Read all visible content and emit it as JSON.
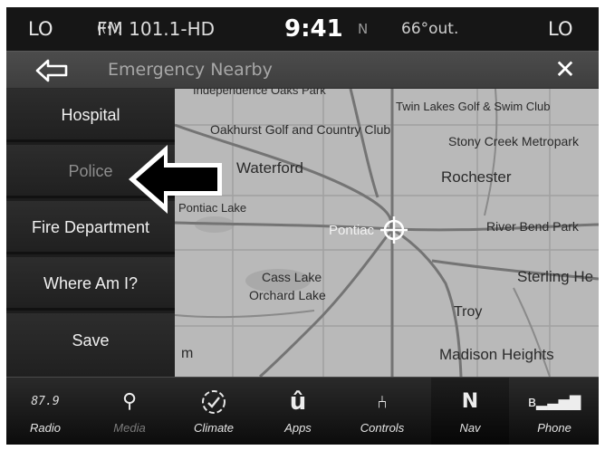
{
  "status": {
    "left_temp": "LO",
    "radio_icon": "radio-signal-icon",
    "station": "FM 101.1-HD",
    "time": "9:41",
    "heading": "N",
    "outside_temp": "66°out.",
    "right_temp": "LO"
  },
  "titlebar": {
    "back_icon": "back-arrow-icon",
    "title": "Emergency Nearby",
    "close_label": "✕"
  },
  "menu": {
    "items": [
      "Hospital",
      "Police",
      "Fire Department",
      "Where Am I?",
      "Save"
    ]
  },
  "map": {
    "labels": [
      "Independence Oaks Park",
      "Twin Lakes Golf & Swim Club",
      "Oakhurst Golf and Country Club",
      "Stony Creek Metropark",
      "Waterford",
      "Rochester",
      "Pontiac Lake",
      "Pontiac",
      "River Bend Park",
      "Cass Lake",
      "Sterling He",
      "Orchard Lake",
      "Troy",
      "m",
      "Madison Heights"
    ],
    "position_icon": "current-location-crosshair-icon",
    "arrow_icon": "pointer-arrow-icon"
  },
  "nav": {
    "items": [
      {
        "label": "Radio",
        "icon_text": "87.9",
        "icon": "radio-frequency-icon"
      },
      {
        "label": "Media",
        "icon_text": "",
        "icon": "usb-icon"
      },
      {
        "label": "Climate",
        "icon_text": "",
        "icon": "climate-fan-icon"
      },
      {
        "label": "Apps",
        "icon_text": "",
        "icon": "apps-icon"
      },
      {
        "label": "Controls",
        "icon_text": "",
        "icon": "controls-seat-icon"
      },
      {
        "label": "Nav",
        "icon_text": "N",
        "icon": "compass-nav-icon"
      },
      {
        "label": "Phone",
        "icon_text": "",
        "icon": "phone-bluetooth-signal-icon"
      }
    ]
  },
  "colors": {
    "background": "#111111",
    "map": "#b9b9b9",
    "menu": "#1d1d1d",
    "road": "#7a7a7a",
    "active_nav": "#0a0a0a"
  }
}
